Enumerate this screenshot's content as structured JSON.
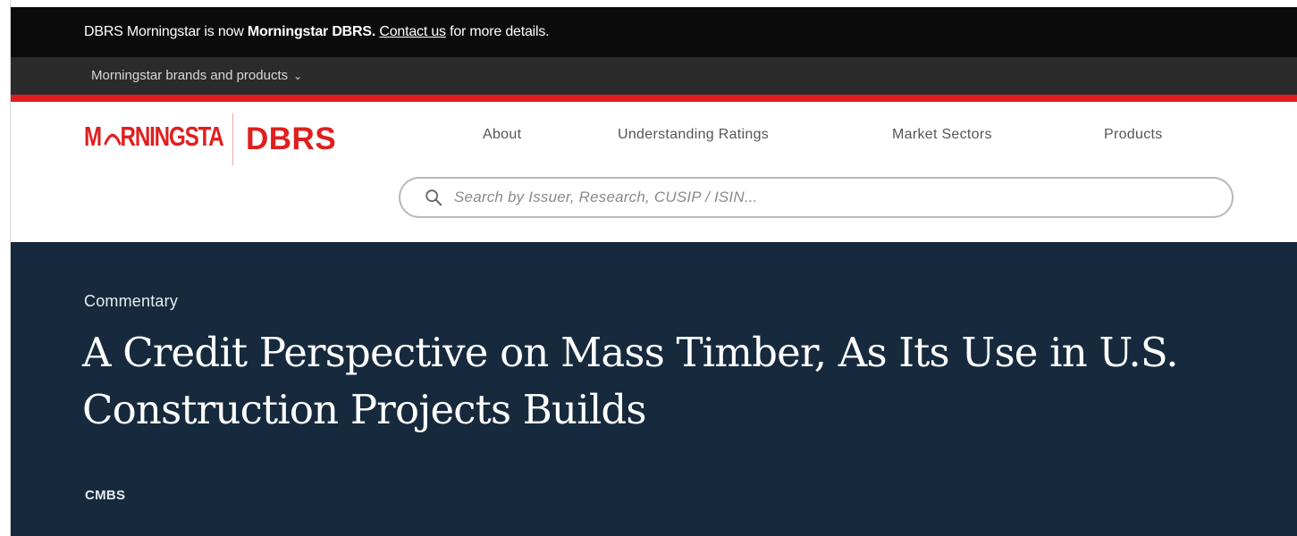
{
  "announcement": {
    "prefix": "DBRS Morningstar is now ",
    "brand": "Morningstar DBRS.",
    "link": "Contact us",
    "suffix": " for more details."
  },
  "brands_menu": {
    "label": "Morningstar brands and products",
    "icon": "chevron-down-icon"
  },
  "header": {
    "logo_left": "MORNINGSTAR",
    "logo_right": "DBRS",
    "nav": [
      {
        "label": "About"
      },
      {
        "label": "Understanding Ratings"
      },
      {
        "label": "Market Sectors"
      },
      {
        "label": "Products"
      }
    ],
    "search": {
      "placeholder": "Search by Issuer, Research, CUSIP / ISIN...",
      "value": "",
      "icon": "search-icon"
    }
  },
  "hero": {
    "eyebrow": "Commentary",
    "title": "A Credit Perspective on Mass Timber, As Its Use in U.S. Construction Projects Builds",
    "tag": "CMBS"
  },
  "colors": {
    "brand_red": "#e01e1e",
    "announce_bg": "#0b0b0b",
    "brands_bg": "#2b2b2b",
    "hero_bg": "#172a3d"
  }
}
